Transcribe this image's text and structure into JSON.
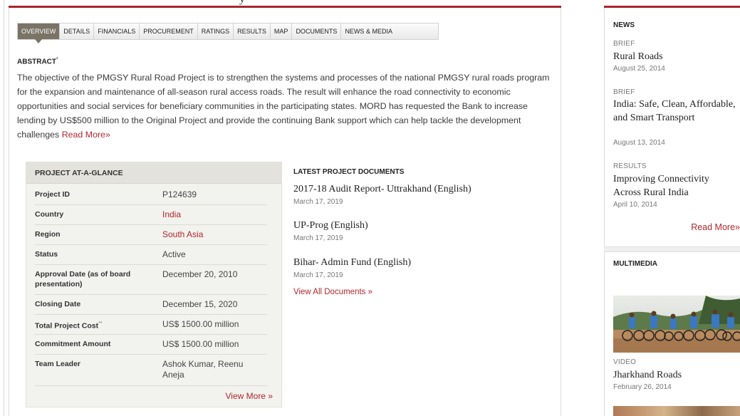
{
  "page": {
    "title_fragment": "y"
  },
  "tabs": [
    {
      "label": "OVERVIEW",
      "active": true
    },
    {
      "label": "DETAILS",
      "active": false
    },
    {
      "label": "FINANCIALS",
      "active": false
    },
    {
      "label": "PROCUREMENT",
      "active": false
    },
    {
      "label": "RATINGS",
      "active": false
    },
    {
      "label": "RESULTS",
      "active": false
    },
    {
      "label": "MAP",
      "active": false
    },
    {
      "label": "DOCUMENTS",
      "active": false
    },
    {
      "label": "NEWS & MEDIA",
      "active": false
    }
  ],
  "abstract": {
    "heading": "ABSTRACT",
    "heading_marker": "*",
    "text": "The objective of the PMGSY Rural Road Project is to strengthen the systems and processes of the national PMGSY rural roads program for the expansion and maintenance of all-season rural access roads. The result will enhance the road connectivity to economic opportunities and social services for beneficiary communities in the participating states. MORD has requested the Bank to increase lending by US$500 million to the Original Project and provide the continuing Bank support which can help tackle the development challenges ",
    "read_more": "Read More»"
  },
  "glance": {
    "heading": "PROJECT AT-A-GLANCE",
    "rows": [
      {
        "label": "Project ID",
        "value": "P124639",
        "link": false
      },
      {
        "label": "Country",
        "value": "India",
        "link": true
      },
      {
        "label": "Region",
        "value": "South Asia",
        "link": true
      },
      {
        "label": "Status",
        "value": "Active",
        "link": false
      },
      {
        "label": "Approval Date (as of board presentation)",
        "value": "December 20, 2010",
        "link": false
      },
      {
        "label": "Closing Date",
        "value": "December 15, 2020",
        "link": false
      },
      {
        "label": "Total Project Cost",
        "label_marker": "**",
        "value": "US$ 1500.00  million",
        "link": false
      },
      {
        "label": "Commitment Amount",
        "value": "US$ 1500.00  million",
        "link": false
      },
      {
        "label": "Team Leader",
        "value": "Ashok Kumar, Reenu Aneja",
        "link": false
      }
    ],
    "view_more": "View More »"
  },
  "documents": {
    "heading": "LATEST PROJECT DOCUMENTS",
    "items": [
      {
        "title": "2017-18 Audit Report- Uttrakhand (English)",
        "date": "March 17, 2019"
      },
      {
        "title": "UP-Prog (English)",
        "date": "March 17, 2019"
      },
      {
        "title": "Bihar- Admin Fund (English)",
        "date": "March 17, 2019"
      }
    ],
    "view_all": "View All Documents »"
  },
  "sidebar": {
    "news_heading": "NEWS",
    "news": [
      {
        "kind": "BRIEF",
        "title": "Rural Roads",
        "date": "August 25, 2014"
      },
      {
        "kind": "BRIEF",
        "title": "India: Safe, Clean, Affordable, and Smart Transport",
        "date": "August 13, 2014"
      },
      {
        "kind": "RESULTS",
        "title": "Improving Connectivity Across Rural India",
        "date": "April 10, 2014"
      }
    ],
    "read_more": "Read More»",
    "multimedia_heading": "MULTIMEDIA",
    "media": {
      "kind": "VIDEO",
      "title": "Jharkhand Roads",
      "date": "February 26, 2014"
    }
  },
  "colors": {
    "accent": "#a8272d",
    "link": "#b0272d",
    "active_tab": "#7a7466"
  }
}
